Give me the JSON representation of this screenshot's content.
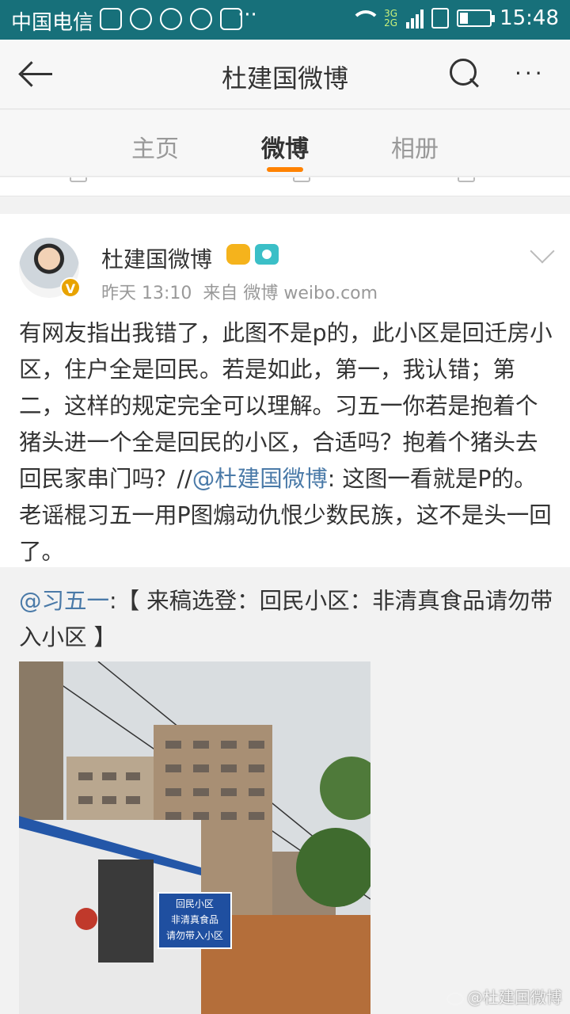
{
  "status_bar": {
    "carrier": "中国电信",
    "dots": "···",
    "network": [
      "3G",
      "2G"
    ],
    "time": "15:48"
  },
  "nav": {
    "title": "杜建国微博",
    "more": "···"
  },
  "tabs": [
    {
      "label": "主页",
      "active": false
    },
    {
      "label": "微博",
      "active": true
    },
    {
      "label": "相册",
      "active": false
    }
  ],
  "post": {
    "author": "杜建国微博",
    "avatar_badge": "V",
    "time": "昨天 13:10",
    "source": "来自 微博 weibo.com",
    "text_main": "有网友指出我错了，此图不是p的，此小区是回迁房小区，住户全是回民。若是如此，第一，我认错；第二，这样的规定完全可以理解。习五一你若是抱着个猪头进一个全是回民的小区，合适吗？抱着个猪头去回民家串门吗？//",
    "text_mention": "@杜建国微博",
    "text_tail": ": 这图一看就是P的。老谣棍习五一用P图煽动仇恨少数民族，这不是头一回了。"
  },
  "retweet": {
    "mention": "@习五一",
    "text": ":【 来稿选登：回民小区：非清真食品请勿带入小区 】",
    "image_sign": [
      "回民小区",
      "非清真食品",
      "请勿带入小区"
    ]
  },
  "watermark": "@杜建国微博",
  "colors": {
    "status_bar": "#17707a",
    "accent": "#ff8200",
    "link": "#4a7aa8"
  }
}
